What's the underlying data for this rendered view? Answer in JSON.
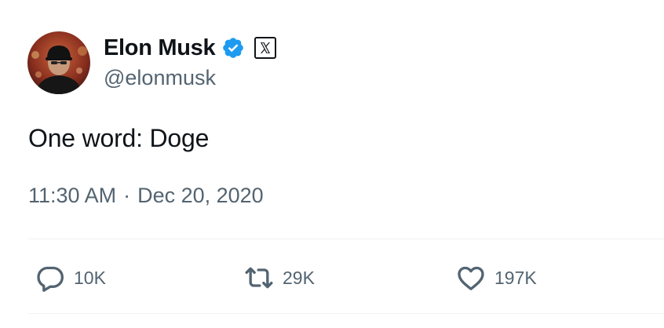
{
  "author": {
    "display_name": "Elon Musk",
    "handle": "@elonmusk",
    "verified": true,
    "verified_color": "#1d9bf0",
    "affiliate_badge_icon": "x-logo-icon"
  },
  "tweet": {
    "text": "One word: Doge",
    "time": "11:30 AM",
    "separator": "·",
    "date": "Dec 20, 2020"
  },
  "actions": {
    "replies": "10K",
    "reposts": "29K",
    "likes": "197K"
  },
  "colors": {
    "text_primary": "#0f1419",
    "text_secondary": "#536471",
    "divider": "#eff3f4",
    "verified": "#1d9bf0"
  },
  "icons": {
    "reply": "speech-bubble-icon",
    "repost": "repost-arrows-icon",
    "like": "heart-icon"
  }
}
